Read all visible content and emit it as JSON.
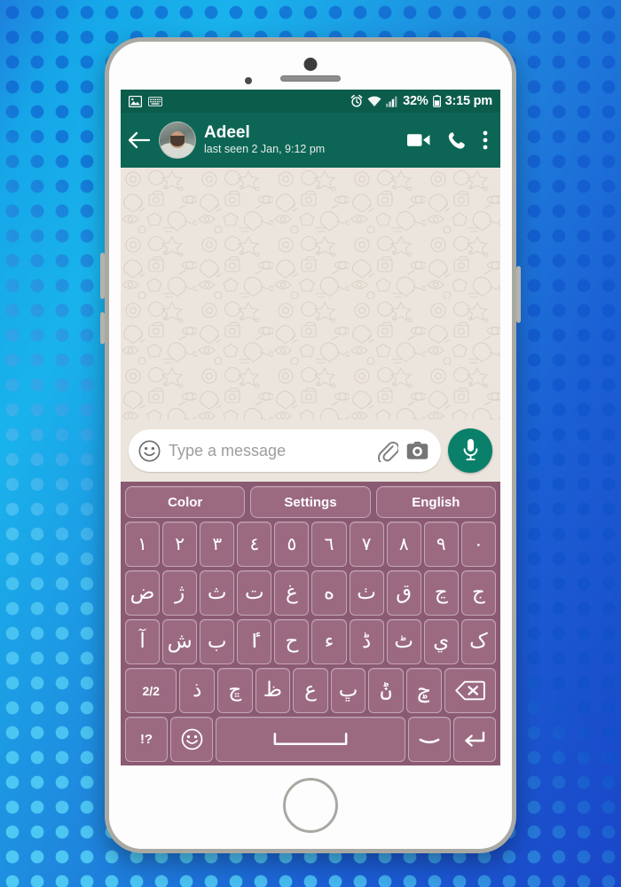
{
  "status_bar": {
    "left_icons": [
      "image-icon",
      "keyboard-icon"
    ],
    "alarm_icon": "alarm-icon",
    "wifi_icon": "wifi-icon",
    "signal_icon": "signal-icon",
    "battery_percent": "32%",
    "battery_icon": "battery-icon",
    "time": "3:15 pm"
  },
  "chat_header": {
    "back_icon": "back-arrow-icon",
    "avatar": "contact-avatar",
    "contact_name": "Adeel",
    "last_seen": "last seen 2 Jan, 9:12 pm",
    "video_call_icon": "video-call-icon",
    "voice_call_icon": "phone-call-icon",
    "overflow_icon": "more-options-icon"
  },
  "input_bar": {
    "emoji_icon": "emoji-icon",
    "placeholder": "Type a message",
    "value": "",
    "attach_icon": "paperclip-icon",
    "camera_icon": "camera-icon",
    "mic_icon": "microphone-icon"
  },
  "keyboard": {
    "toolbar": [
      {
        "label": "Color",
        "name": "color-button"
      },
      {
        "label": "Settings",
        "name": "settings-button"
      },
      {
        "label": "English",
        "name": "english-language-button"
      }
    ],
    "rows": [
      {
        "name": "number-row",
        "keys": [
          {
            "label": "١",
            "name": "key-1"
          },
          {
            "label": "٢",
            "name": "key-2"
          },
          {
            "label": "٣",
            "name": "key-3"
          },
          {
            "label": "٤",
            "name": "key-4"
          },
          {
            "label": "٥",
            "name": "key-5"
          },
          {
            "label": "٦",
            "name": "key-6"
          },
          {
            "label": "٧",
            "name": "key-7"
          },
          {
            "label": "٨",
            "name": "key-8"
          },
          {
            "label": "٩",
            "name": "key-9"
          },
          {
            "label": "٠",
            "name": "key-0"
          }
        ]
      },
      {
        "name": "letter-row-1",
        "keys": [
          {
            "label": "ض",
            "name": "key-dad"
          },
          {
            "label": "ژ",
            "name": "key-zhe"
          },
          {
            "label": "ث",
            "name": "key-the"
          },
          {
            "label": "ت",
            "name": "key-te"
          },
          {
            "label": "غ",
            "name": "key-ghain"
          },
          {
            "label": "ه",
            "name": "key-he"
          },
          {
            "label": "ٺ",
            "name": "key-tte"
          },
          {
            "label": "ق",
            "name": "key-qaf"
          },
          {
            "label": "ڃ",
            "name": "key-nyeh"
          },
          {
            "label": "ج",
            "name": "key-jeem"
          }
        ]
      },
      {
        "name": "letter-row-2",
        "keys": [
          {
            "label": "آ",
            "name": "key-alef-madda"
          },
          {
            "label": "ش",
            "name": "key-sheen"
          },
          {
            "label": "ب",
            "name": "key-be"
          },
          {
            "label": "ٵ",
            "name": "key-hamza-alef"
          },
          {
            "label": "ح",
            "name": "key-hah"
          },
          {
            "label": "ء",
            "name": "key-hamza"
          },
          {
            "label": "ڈ",
            "name": "key-ddal"
          },
          {
            "label": "ٹ",
            "name": "key-tteh"
          },
          {
            "label": "ي",
            "name": "key-yeh"
          },
          {
            "label": "ک",
            "name": "key-kaf"
          }
        ]
      },
      {
        "name": "letter-row-3",
        "keys": [
          {
            "label": "2/2",
            "name": "key-page-toggle",
            "type": "func"
          },
          {
            "label": "ذ",
            "name": "key-zal"
          },
          {
            "label": "ڇ",
            "name": "key-cheh"
          },
          {
            "label": "ظ",
            "name": "key-zah"
          },
          {
            "label": "ع",
            "name": "key-ain"
          },
          {
            "label": "ڀ",
            "name": "key-bheh"
          },
          {
            "label": "ݨ",
            "name": "key-noon-ring"
          },
          {
            "label": "ݮ",
            "name": "key-meem-dots"
          },
          {
            "label": "backspace-icon",
            "name": "key-backspace",
            "type": "icon",
            "icon": "backspace-icon",
            "flex": "1.5"
          }
        ]
      },
      {
        "name": "bottom-row",
        "keys": [
          {
            "label": "!?",
            "name": "key-symbols",
            "type": "func"
          },
          {
            "label": "emoji-icon",
            "name": "key-emoji",
            "type": "icon",
            "icon": "emoji-icon"
          },
          {
            "label": "space-icon",
            "name": "key-space",
            "type": "icon",
            "icon": "space-icon",
            "flex": "space"
          },
          {
            "label": "dash-icon",
            "name": "key-dash",
            "type": "icon",
            "icon": "dash-icon"
          },
          {
            "label": "enter-icon",
            "name": "key-enter",
            "type": "icon",
            "icon": "enter-icon"
          }
        ]
      }
    ]
  },
  "device": {
    "home_button": "home-button",
    "front_camera": "front-camera",
    "earpiece": "earpiece-speaker"
  },
  "colors": {
    "status_bar": "#0c5c4c",
    "header": "#0d6655",
    "wallpaper": "#ece5dd",
    "keyboard_bg": "#8a5a72",
    "key_bg": "#9b6a81",
    "mic_green": "#0a806a",
    "background_blue": "#1f86dd"
  }
}
